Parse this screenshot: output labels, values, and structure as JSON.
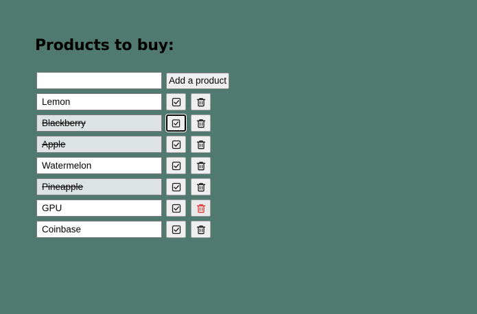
{
  "page": {
    "title": "Products to buy:"
  },
  "form": {
    "new_item_value": "",
    "add_label": "Add a product"
  },
  "items": [
    {
      "name": "Lemon",
      "done": false
    },
    {
      "name": "Blackberry",
      "done": true
    },
    {
      "name": "Apple",
      "done": true
    },
    {
      "name": "Watermelon",
      "done": false
    },
    {
      "name": "Pineapple",
      "done": true
    },
    {
      "name": "GPU",
      "done": false
    },
    {
      "name": "Coinbase",
      "done": false
    }
  ],
  "icons": {
    "check": "checkbox-check-icon",
    "delete": "trash-icon"
  },
  "colors": {
    "background": "#507a6f",
    "done_item_background": "#dde3e2",
    "delete_hover": "#e03131"
  }
}
